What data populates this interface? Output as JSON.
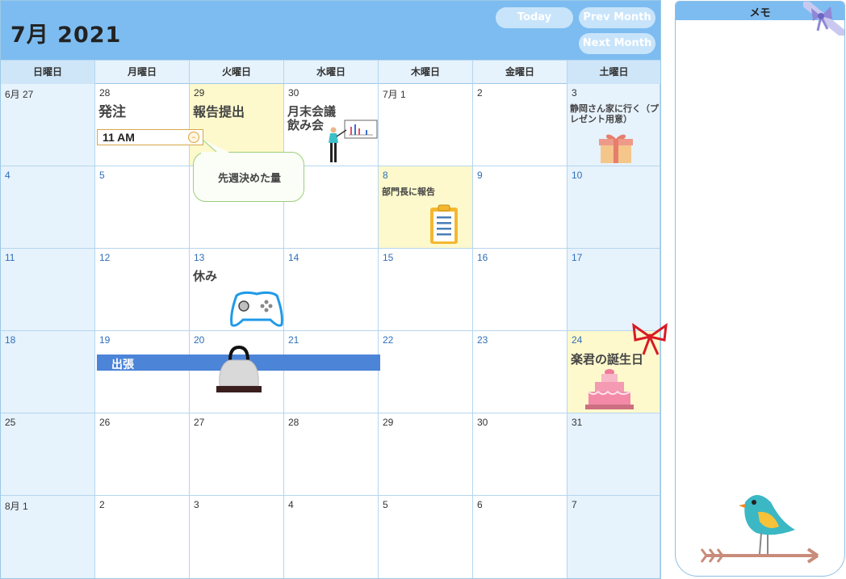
{
  "calendar": {
    "title": "7月 2021",
    "buttons": {
      "today": "Today",
      "prev": "Prev Month",
      "next": "Next Month"
    },
    "weekdays": [
      "日曜日",
      "月曜日",
      "火曜日",
      "水曜日",
      "木曜日",
      "金曜日",
      "土曜日"
    ],
    "weeks": [
      [
        "6月 27",
        "28",
        "29",
        "30",
        "7月 1",
        "2",
        "3"
      ],
      [
        "4",
        "5",
        "6",
        "7",
        "8",
        "9",
        "10"
      ],
      [
        "11",
        "12",
        "13",
        "14",
        "15",
        "16",
        "17"
      ],
      [
        "18",
        "19",
        "20",
        "21",
        "22",
        "23",
        "24"
      ],
      [
        "25",
        "26",
        "27",
        "28",
        "29",
        "30",
        "31"
      ],
      [
        "8月 1",
        "2",
        "3",
        "4",
        "5",
        "6",
        "7"
      ]
    ],
    "events": {
      "order": "発注",
      "report_submit": "報告提出",
      "month_end_meeting": "月末会議\n飲み会",
      "visit_shizuoka": "静岡さん家に行く（プレゼント用意）",
      "report_to_manager": "部門長に報告",
      "holiday": "休み",
      "business_trip": "出張",
      "birthday": "楽君の誕生日"
    },
    "time_input_value": "11 AM",
    "tooltip_text": "先週決めた量",
    "colors": {
      "header": "#7dbcf0",
      "highlight": "#fdf9cc",
      "trip_bar": "#4c84d8"
    }
  },
  "memo": {
    "title": "メモ"
  },
  "icons": [
    "chart-presenter-icon",
    "gift-box-icon",
    "clipboard-icon",
    "gamepad-icon",
    "handbag-icon",
    "ribbon-bow-icon",
    "cake-icon",
    "bird-on-branch-icon",
    "memo-ribbon-icon"
  ]
}
